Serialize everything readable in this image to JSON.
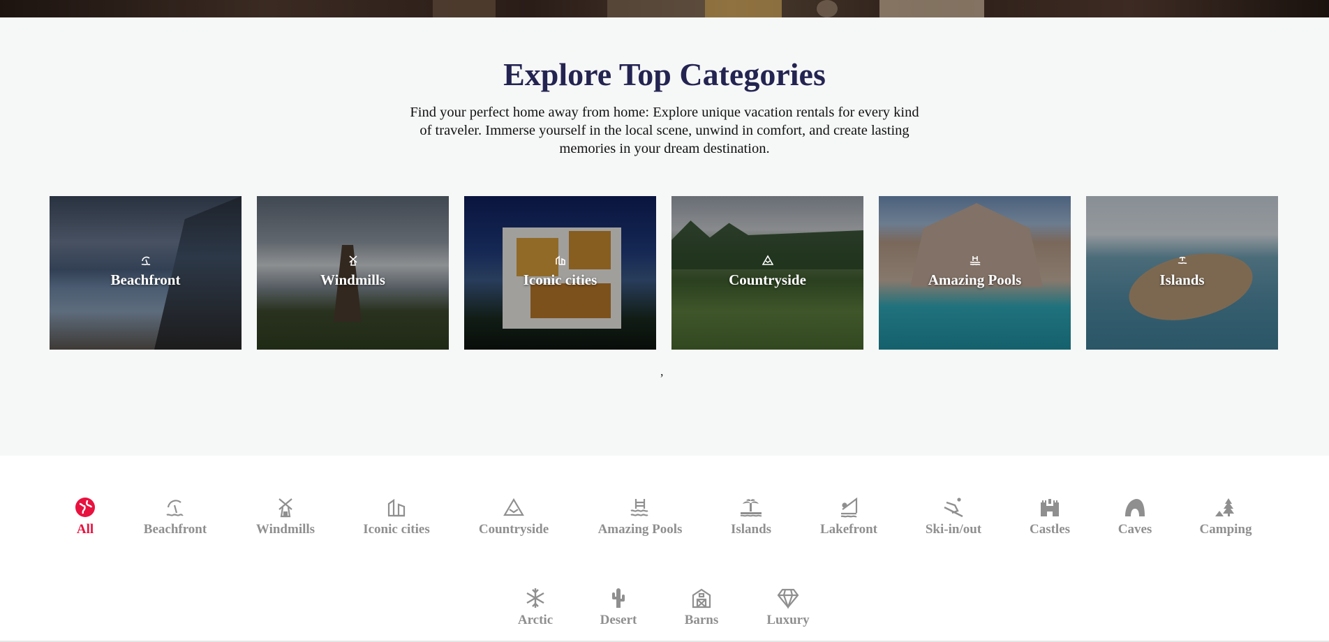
{
  "section": {
    "title": "Explore Top Categories",
    "description": "Find your perfect home away from home: Explore unique vacation rentals for every kind of traveler. Immerse yourself in the local scene, unwind in comfort, and create lasting memories in your dream destination.",
    "separator": ","
  },
  "cards": [
    {
      "label": "Beachfront",
      "icon": "beach-icon"
    },
    {
      "label": "Windmills",
      "icon": "windmill-icon"
    },
    {
      "label": "Iconic cities",
      "icon": "city-icon"
    },
    {
      "label": "Countryside",
      "icon": "mountain-icon"
    },
    {
      "label": "Amazing Pools",
      "icon": "pool-icon"
    },
    {
      "label": "Islands",
      "icon": "island-icon"
    }
  ],
  "categories": [
    {
      "label": "All",
      "icon": "globe-icon",
      "active": true
    },
    {
      "label": "Beachfront",
      "icon": "beach-icon"
    },
    {
      "label": "Windmills",
      "icon": "windmill-icon"
    },
    {
      "label": "Iconic cities",
      "icon": "city-icon"
    },
    {
      "label": "Countryside",
      "icon": "mountain-icon"
    },
    {
      "label": "Amazing Pools",
      "icon": "pool-icon"
    },
    {
      "label": "Islands",
      "icon": "island-icon"
    },
    {
      "label": "Lakefront",
      "icon": "fishing-icon"
    },
    {
      "label": "Ski-in/out",
      "icon": "skiing-icon"
    },
    {
      "label": "Castles",
      "icon": "castle-icon"
    },
    {
      "label": "Caves",
      "icon": "cave-icon"
    },
    {
      "label": "Camping",
      "icon": "camping-icon"
    },
    {
      "label": "Arctic",
      "icon": "snowflake-icon"
    },
    {
      "label": "Desert",
      "icon": "cactus-icon"
    },
    {
      "label": "Barns",
      "icon": "barn-icon"
    },
    {
      "label": "Luxury",
      "icon": "diamond-icon"
    }
  ],
  "colors": {
    "title": "#242452",
    "active": "#e8123f",
    "inactive": "#8f8f8f",
    "section_bg": "#f6f7f7"
  }
}
